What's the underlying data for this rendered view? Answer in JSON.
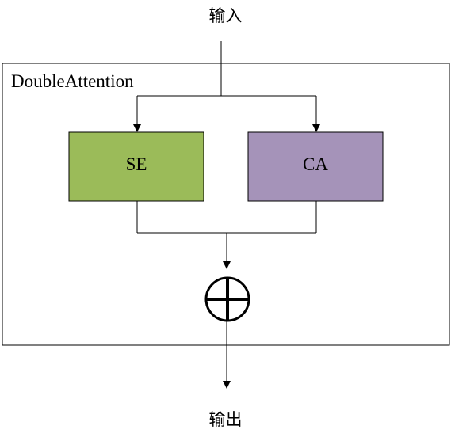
{
  "input_label": "输入",
  "output_label": "输出",
  "module": {
    "title": "DoubleAttention"
  },
  "blocks": {
    "se": {
      "label": "SE",
      "color": "#9bbb59"
    },
    "ca": {
      "label": "CA",
      "color": "#a593b9"
    }
  },
  "merge_operator": {
    "symbol": "add-circle"
  },
  "colors": {
    "stroke": "#000000",
    "background": "#ffffff"
  }
}
